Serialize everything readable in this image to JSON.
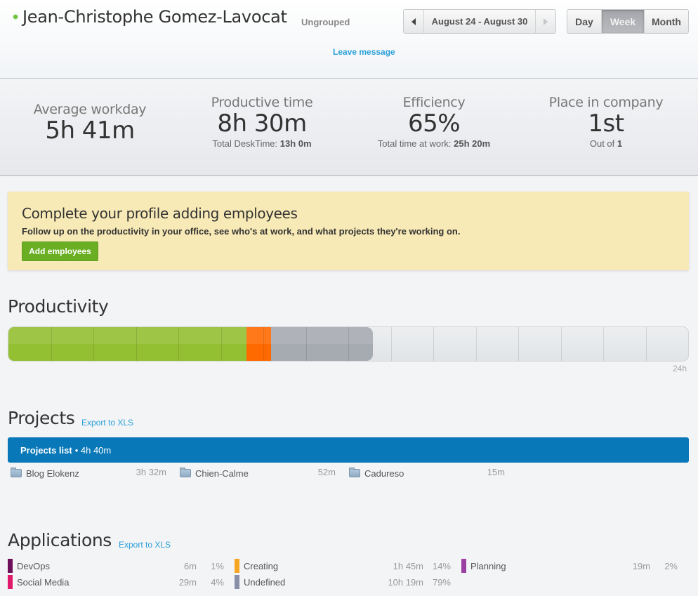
{
  "header": {
    "user_name": "Jean-Christophe Gomez-Lavocat",
    "group": "Ungrouped",
    "leave_message": "Leave message",
    "status_color": "#6cc23a",
    "date_range": "August 24 - August 30",
    "periods": [
      {
        "label": "Day",
        "active": false
      },
      {
        "label": "Week",
        "active": true
      },
      {
        "label": "Month",
        "active": false
      }
    ]
  },
  "stats": {
    "average_workday": {
      "label": "Average workday",
      "value": "5h 41m"
    },
    "productive_time": {
      "label": "Productive time",
      "value": "8h 30m",
      "sub_label": "Total DeskTime:",
      "sub_value": "13h 0m"
    },
    "efficiency": {
      "label": "Efficiency",
      "value": "65%",
      "sub_label": "Total time at work:",
      "sub_value": "25h 20m"
    },
    "place": {
      "label": "Place in company",
      "value": "1st",
      "sub_label": "Out of",
      "sub_value": "1"
    }
  },
  "promo": {
    "title": "Complete your profile adding employees",
    "description": "Follow up on the productivity in your office, see who's at work, and what projects they're working on.",
    "button_label": "Add employees"
  },
  "productivity": {
    "title": "Productivity",
    "axis_end_label": "24h",
    "total_hours": 24,
    "tick_interval_hours": 1.5,
    "segments": [
      {
        "type": "productive",
        "hours": 8.4,
        "color": "#93bf32"
      },
      {
        "type": "unproductive",
        "hours": 0.87,
        "color": "#ff6a00"
      },
      {
        "type": "neutral",
        "hours": 3.6,
        "color": "#a6abb2"
      }
    ]
  },
  "projects": {
    "title": "Projects",
    "export_label": "Export to XLS",
    "list_label": "Projects list",
    "list_total": "• 4h 40m",
    "accent_color": "#0878b8",
    "items": [
      {
        "name": "Blog Elokenz",
        "time": "3h 32m"
      },
      {
        "name": "Chien-Calme",
        "time": "52m"
      },
      {
        "name": "Cadureso",
        "time": "15m"
      }
    ]
  },
  "applications": {
    "title": "Applications",
    "export_label": "Export to XLS",
    "items": [
      {
        "name": "DevOps",
        "time": "6m",
        "percent": "1%",
        "color": "#6e0f5a"
      },
      {
        "name": "Social Media",
        "time": "29m",
        "percent": "4%",
        "color": "#e0196a"
      },
      {
        "name": "Creating",
        "time": "1h 45m",
        "percent": "14%",
        "color": "#f5a623"
      },
      {
        "name": "Undefined",
        "time": "10h 19m",
        "percent": "79%",
        "color": "#8a8fa8"
      },
      {
        "name": "Planning",
        "time": "19m",
        "percent": "2%",
        "color": "#9b3fa3"
      }
    ]
  }
}
